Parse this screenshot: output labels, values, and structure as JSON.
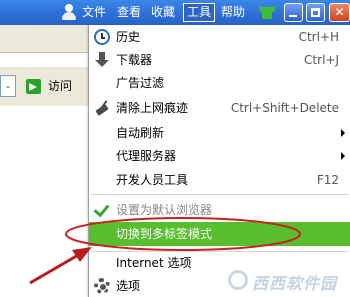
{
  "menubar": {
    "file": "文件",
    "view": "查看",
    "favorites": "收藏",
    "tools": "工具",
    "help": "帮助"
  },
  "window_buttons": {
    "close_glyph": "✕"
  },
  "toolbar": {
    "go_label": "访问",
    "addr_dropdown": "⌄"
  },
  "tools_menu": {
    "items": [
      {
        "label": "历史",
        "shortcut": "Ctrl+H",
        "icon": "clock-icon"
      },
      {
        "label": "下载器",
        "shortcut": "Ctrl+J",
        "icon": "download-icon"
      },
      {
        "label": "广告过滤",
        "shortcut": ""
      },
      {
        "label": "清除上网痕迹",
        "shortcut": "Ctrl+Shift+Delete",
        "icon": "broom-icon"
      },
      {
        "label": "自动刷新",
        "submenu": true
      },
      {
        "label": "代理服务器",
        "submenu": true
      },
      {
        "label": "开发人员工具",
        "shortcut": "F12"
      },
      {
        "label": "设置为默认浏览器",
        "disabled": true,
        "icon": "check-icon"
      },
      {
        "label": "切换到多标签模式",
        "highlighted": true
      },
      {
        "label": "Internet 选项"
      },
      {
        "label": "选项",
        "icon": "gear-icon"
      }
    ]
  },
  "colors": {
    "titlebar": "#2f6fd6",
    "highlight": "#57bf2e",
    "annotation": "#cc1f1f"
  },
  "watermark": {
    "text": "西西软件园"
  }
}
